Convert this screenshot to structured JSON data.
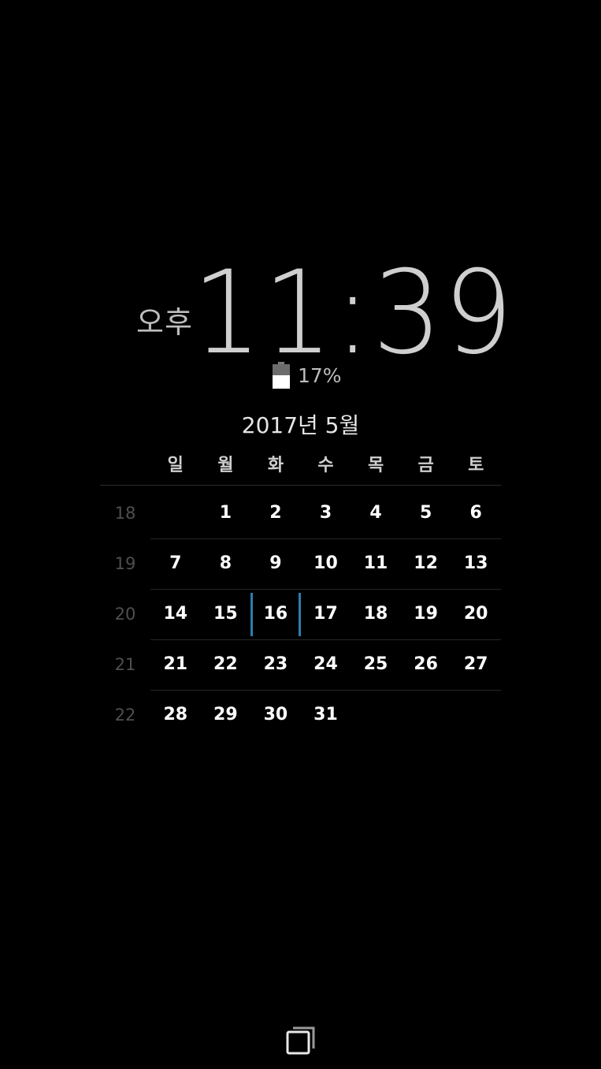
{
  "clock": {
    "ampm": "오후",
    "time": "11:39"
  },
  "battery": {
    "percent_label": "17%",
    "level": 0.55
  },
  "calendar": {
    "title": "2017년 5월",
    "weekdays": [
      "일",
      "월",
      "화",
      "수",
      "목",
      "금",
      "토"
    ],
    "weeks": [
      {
        "week": "18",
        "days": [
          "",
          "1",
          "2",
          "3",
          "4",
          "5",
          "6"
        ]
      },
      {
        "week": "19",
        "days": [
          "7",
          "8",
          "9",
          "10",
          "11",
          "12",
          "13"
        ]
      },
      {
        "week": "20",
        "days": [
          "14",
          "15",
          "16",
          "17",
          "18",
          "19",
          "20"
        ]
      },
      {
        "week": "21",
        "days": [
          "21",
          "22",
          "23",
          "24",
          "25",
          "26",
          "27"
        ]
      },
      {
        "week": "22",
        "days": [
          "28",
          "29",
          "30",
          "31",
          "",
          "",
          ""
        ]
      }
    ],
    "today": "16"
  },
  "colors": {
    "background": "#000000",
    "today_marker": "#2a7fb0"
  },
  "icons": {
    "battery": "battery-icon",
    "nav": "recent-apps-icon"
  }
}
